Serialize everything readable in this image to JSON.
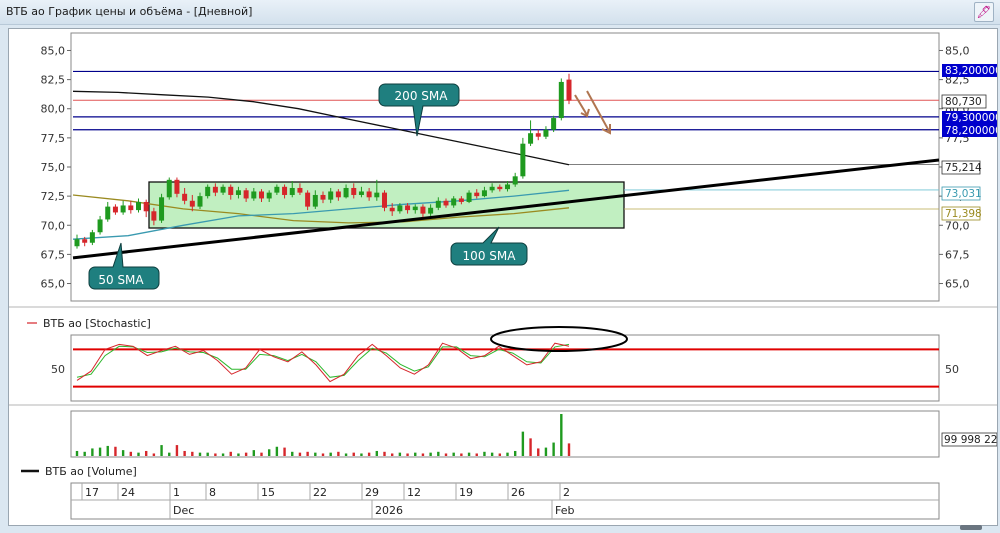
{
  "window": {
    "title": "ВТБ ао График цены и объёма - [Дневной]",
    "pin_icon": "pin-icon"
  },
  "price_axis": {
    "ticks": [
      "85,0",
      "82,5",
      "80,0",
      "77,5",
      "75,0",
      "72,5",
      "70,0",
      "67,5",
      "65,0"
    ],
    "tick_values": [
      85,
      82.5,
      80,
      77.5,
      75,
      72.5,
      70,
      67.5,
      65
    ]
  },
  "price_labels": {
    "level_832": "83,200000",
    "level_8073": "80,730",
    "level_793": "79,300000",
    "level_782": "78,200000",
    "level_75214": "75,214",
    "level_73031": "73,031",
    "level_71398": "71,398"
  },
  "annotations": {
    "sma200": "200 SMA",
    "sma100": "100 SMA",
    "sma50": "50 SMA"
  },
  "stochastic": {
    "legend": "ВТБ ао [Stochastic]",
    "tick": "50"
  },
  "volume": {
    "legend": "ВТБ ао [Volume]",
    "value_label": "99 998 22"
  },
  "time_axis": {
    "day_labels": [
      "17",
      "24",
      "1",
      "8",
      "15",
      "22",
      "29",
      "12",
      "19",
      "26",
      "2"
    ],
    "month_labels": [
      "Dec",
      "2026",
      "Feb"
    ]
  },
  "colors": {
    "up": "#1f9a1f",
    "down": "#d6262b",
    "level_blue": "#00008b",
    "level_red": "#e05555",
    "stoch_band": "#e00000",
    "box_fill": "#9fe79f",
    "callout": "#1f7f7f",
    "sma50": "#3a9ab0",
    "sma100": "#9a8a20"
  },
  "chart_data": {
    "type": "candlestick",
    "price_range": [
      63.5,
      86.5
    ],
    "horizontal_levels": [
      83.2,
      80.73,
      79.3,
      78.2,
      75.214,
      73.031,
      71.398
    ],
    "candles": [
      {
        "o": 68.2,
        "c": 68.8,
        "h": 69.2,
        "l": 68.0
      },
      {
        "o": 68.8,
        "c": 68.5,
        "h": 69.0,
        "l": 68.2
      },
      {
        "o": 68.5,
        "c": 69.4,
        "h": 69.6,
        "l": 68.3
      },
      {
        "o": 69.4,
        "c": 70.5,
        "h": 70.8,
        "l": 69.2
      },
      {
        "o": 70.5,
        "c": 71.6,
        "h": 72.0,
        "l": 70.3
      },
      {
        "o": 71.6,
        "c": 71.1,
        "h": 71.8,
        "l": 70.9
      },
      {
        "o": 71.1,
        "c": 71.7,
        "h": 72.1,
        "l": 70.9
      },
      {
        "o": 71.7,
        "c": 71.3,
        "h": 72.1,
        "l": 71.0
      },
      {
        "o": 71.3,
        "c": 72.0,
        "h": 72.3,
        "l": 71.1
      },
      {
        "o": 72.0,
        "c": 71.2,
        "h": 72.2,
        "l": 70.7
      },
      {
        "o": 71.2,
        "c": 70.4,
        "h": 71.5,
        "l": 70.0
      },
      {
        "o": 70.4,
        "c": 72.4,
        "h": 72.7,
        "l": 70.2
      },
      {
        "o": 72.4,
        "c": 73.9,
        "h": 74.1,
        "l": 72.2
      },
      {
        "o": 73.9,
        "c": 72.7,
        "h": 74.1,
        "l": 72.4
      },
      {
        "o": 72.7,
        "c": 72.1,
        "h": 73.2,
        "l": 71.8
      },
      {
        "o": 72.1,
        "c": 71.6,
        "h": 72.6,
        "l": 71.2
      },
      {
        "o": 71.6,
        "c": 72.5,
        "h": 72.8,
        "l": 71.4
      },
      {
        "o": 72.5,
        "c": 73.3,
        "h": 73.5,
        "l": 72.3
      },
      {
        "o": 73.3,
        "c": 72.8,
        "h": 73.6,
        "l": 72.5
      },
      {
        "o": 72.8,
        "c": 73.3,
        "h": 73.5,
        "l": 72.6
      },
      {
        "o": 73.3,
        "c": 72.6,
        "h": 73.5,
        "l": 72.2
      },
      {
        "o": 72.6,
        "c": 73.0,
        "h": 73.3,
        "l": 72.3
      },
      {
        "o": 73.0,
        "c": 72.3,
        "h": 73.2,
        "l": 72.0
      },
      {
        "o": 72.3,
        "c": 72.9,
        "h": 73.2,
        "l": 72.1
      },
      {
        "o": 72.9,
        "c": 72.3,
        "h": 73.1,
        "l": 72.0
      },
      {
        "o": 72.3,
        "c": 72.8,
        "h": 73.0,
        "l": 72.0
      },
      {
        "o": 72.8,
        "c": 73.3,
        "h": 73.5,
        "l": 72.6
      },
      {
        "o": 73.3,
        "c": 72.6,
        "h": 73.5,
        "l": 72.3
      },
      {
        "o": 72.6,
        "c": 73.2,
        "h": 73.8,
        "l": 72.4
      },
      {
        "o": 73.2,
        "c": 72.8,
        "h": 73.6,
        "l": 72.6
      },
      {
        "o": 72.8,
        "c": 71.6,
        "h": 73.0,
        "l": 71.3
      },
      {
        "o": 71.6,
        "c": 72.6,
        "h": 73.0,
        "l": 71.4
      },
      {
        "o": 72.6,
        "c": 72.2,
        "h": 72.9,
        "l": 71.9
      },
      {
        "o": 72.2,
        "c": 72.9,
        "h": 73.2,
        "l": 71.9
      },
      {
        "o": 72.9,
        "c": 72.4,
        "h": 73.1,
        "l": 72.1
      },
      {
        "o": 72.4,
        "c": 73.2,
        "h": 73.5,
        "l": 72.3
      },
      {
        "o": 73.2,
        "c": 72.6,
        "h": 73.6,
        "l": 72.3
      },
      {
        "o": 72.6,
        "c": 72.9,
        "h": 73.3,
        "l": 72.4
      },
      {
        "o": 72.9,
        "c": 72.4,
        "h": 73.2,
        "l": 72.1
      },
      {
        "o": 72.4,
        "c": 72.8,
        "h": 73.9,
        "l": 72.1
      },
      {
        "o": 72.8,
        "c": 71.5,
        "h": 73.0,
        "l": 71.2
      },
      {
        "o": 71.5,
        "c": 71.2,
        "h": 71.9,
        "l": 70.8
      },
      {
        "o": 71.2,
        "c": 71.7,
        "h": 71.9,
        "l": 71.0
      },
      {
        "o": 71.7,
        "c": 71.3,
        "h": 71.9,
        "l": 71.0
      },
      {
        "o": 71.3,
        "c": 71.6,
        "h": 71.8,
        "l": 71.0
      },
      {
        "o": 71.6,
        "c": 71.0,
        "h": 71.8,
        "l": 70.7
      },
      {
        "o": 71.0,
        "c": 71.5,
        "h": 71.8,
        "l": 70.8
      },
      {
        "o": 71.5,
        "c": 72.1,
        "h": 72.4,
        "l": 71.3
      },
      {
        "o": 72.1,
        "c": 71.7,
        "h": 72.3,
        "l": 71.5
      },
      {
        "o": 71.7,
        "c": 72.3,
        "h": 72.5,
        "l": 71.5
      },
      {
        "o": 72.3,
        "c": 72.0,
        "h": 72.5,
        "l": 71.8
      },
      {
        "o": 72.0,
        "c": 72.8,
        "h": 73.0,
        "l": 71.9
      },
      {
        "o": 72.8,
        "c": 72.5,
        "h": 73.1,
        "l": 72.3
      },
      {
        "o": 72.5,
        "c": 73.0,
        "h": 73.3,
        "l": 72.4
      },
      {
        "o": 73.0,
        "c": 73.3,
        "h": 73.6,
        "l": 72.8
      },
      {
        "o": 73.3,
        "c": 73.1,
        "h": 73.5,
        "l": 72.9
      },
      {
        "o": 73.1,
        "c": 73.5,
        "h": 73.8,
        "l": 72.9
      },
      {
        "o": 73.5,
        "c": 74.2,
        "h": 74.5,
        "l": 73.3
      },
      {
        "o": 74.2,
        "c": 77.0,
        "h": 77.5,
        "l": 74.0
      },
      {
        "o": 77.0,
        "c": 77.9,
        "h": 79.0,
        "l": 76.8
      },
      {
        "o": 77.9,
        "c": 77.6,
        "h": 78.2,
        "l": 77.3
      },
      {
        "o": 77.6,
        "c": 78.2,
        "h": 78.5,
        "l": 77.4
      },
      {
        "o": 78.2,
        "c": 79.2,
        "h": 79.4,
        "l": 78.0
      },
      {
        "o": 79.2,
        "c": 82.3,
        "h": 82.6,
        "l": 79.0
      },
      {
        "o": 82.5,
        "c": 80.7,
        "h": 83.0,
        "l": 80.4
      }
    ],
    "sma200": [
      81.5,
      81.4,
      81.2,
      81.0,
      80.6,
      80.0,
      79.2,
      78.4,
      77.6,
      76.8,
      76.0,
      75.2
    ],
    "sma100": [
      72.6,
      72.1,
      71.4,
      71.0,
      70.4,
      70.2,
      70.3,
      70.7,
      71.0,
      71.5
    ],
    "sma50": [
      68.8,
      69.1,
      70.0,
      70.8,
      71.0,
      71.4,
      71.8,
      72.1,
      72.5,
      73.0
    ],
    "trendline": [
      67.2,
      75.6
    ],
    "stochastic_k": [
      30,
      45,
      80,
      88,
      85,
      70,
      78,
      85,
      72,
      78,
      62,
      40,
      50,
      80,
      68,
      60,
      76,
      55,
      28,
      40,
      70,
      88,
      70,
      50,
      40,
      55,
      90,
      82,
      65,
      70,
      85,
      70,
      55,
      60,
      90,
      85
    ],
    "stochastic_d": [
      35,
      40,
      70,
      85,
      84,
      75,
      76,
      82,
      76,
      75,
      66,
      48,
      48,
      72,
      70,
      62,
      72,
      60,
      35,
      38,
      62,
      82,
      74,
      56,
      45,
      52,
      84,
      84,
      70,
      68,
      80,
      74,
      60,
      58,
      84,
      88
    ],
    "stochastic_bands": [
      80,
      20
    ],
    "volume": [
      {
        "v": 0.12,
        "up": true
      },
      {
        "v": 0.1,
        "up": true
      },
      {
        "v": 0.18,
        "up": true
      },
      {
        "v": 0.2,
        "up": true
      },
      {
        "v": 0.24,
        "up": true
      },
      {
        "v": 0.22,
        "up": false
      },
      {
        "v": 0.14,
        "up": true
      },
      {
        "v": 0.1,
        "up": false
      },
      {
        "v": 0.08,
        "up": true
      },
      {
        "v": 0.12,
        "up": false
      },
      {
        "v": 0.06,
        "up": false
      },
      {
        "v": 0.26,
        "up": true
      },
      {
        "v": 0.08,
        "up": true
      },
      {
        "v": 0.26,
        "up": false
      },
      {
        "v": 0.12,
        "up": false
      },
      {
        "v": 0.1,
        "up": false
      },
      {
        "v": 0.08,
        "up": true
      },
      {
        "v": 0.08,
        "up": true
      },
      {
        "v": 0.06,
        "up": false
      },
      {
        "v": 0.06,
        "up": true
      },
      {
        "v": 0.1,
        "up": false
      },
      {
        "v": 0.06,
        "up": true
      },
      {
        "v": 0.08,
        "up": false
      },
      {
        "v": 0.14,
        "up": true
      },
      {
        "v": 0.08,
        "up": false
      },
      {
        "v": 0.16,
        "up": true
      },
      {
        "v": 0.22,
        "up": true
      },
      {
        "v": 0.2,
        "up": false
      },
      {
        "v": 0.1,
        "up": true
      },
      {
        "v": 0.08,
        "up": false
      },
      {
        "v": 0.1,
        "up": false
      },
      {
        "v": 0.08,
        "up": true
      },
      {
        "v": 0.06,
        "up": false
      },
      {
        "v": 0.08,
        "up": true
      },
      {
        "v": 0.1,
        "up": false
      },
      {
        "v": 0.06,
        "up": true
      },
      {
        "v": 0.08,
        "up": false
      },
      {
        "v": 0.06,
        "up": true
      },
      {
        "v": 0.08,
        "up": false
      },
      {
        "v": 0.12,
        "up": true
      },
      {
        "v": 0.1,
        "up": false
      },
      {
        "v": 0.06,
        "up": false
      },
      {
        "v": 0.08,
        "up": true
      },
      {
        "v": 0.06,
        "up": false
      },
      {
        "v": 0.08,
        "up": true
      },
      {
        "v": 0.06,
        "up": false
      },
      {
        "v": 0.08,
        "up": true
      },
      {
        "v": 0.1,
        "up": true
      },
      {
        "v": 0.06,
        "up": false
      },
      {
        "v": 0.08,
        "up": true
      },
      {
        "v": 0.06,
        "up": false
      },
      {
        "v": 0.08,
        "up": true
      },
      {
        "v": 0.06,
        "up": false
      },
      {
        "v": 0.1,
        "up": true
      },
      {
        "v": 0.08,
        "up": true
      },
      {
        "v": 0.06,
        "up": false
      },
      {
        "v": 0.08,
        "up": true
      },
      {
        "v": 0.12,
        "up": true
      },
      {
        "v": 0.58,
        "up": true
      },
      {
        "v": 0.42,
        "up": false
      },
      {
        "v": 0.18,
        "up": false
      },
      {
        "v": 0.2,
        "up": true
      },
      {
        "v": 0.32,
        "up": true
      },
      {
        "v": 1.0,
        "up": true
      },
      {
        "v": 0.3,
        "up": false
      }
    ]
  }
}
